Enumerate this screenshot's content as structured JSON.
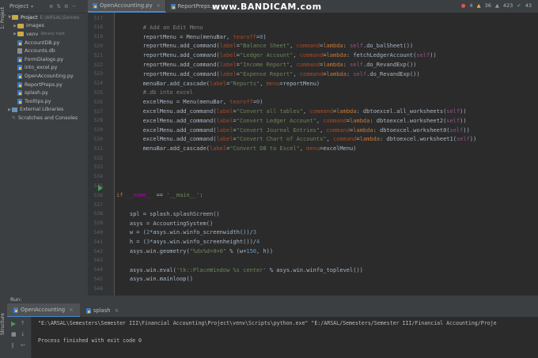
{
  "project_panel": {
    "title": "Project",
    "root": {
      "name": "Project",
      "path": "E:\\ARSAL\\Semes"
    },
    "items": [
      {
        "label": "images",
        "type": "folder",
        "note": ""
      },
      {
        "label": "venv",
        "type": "folder",
        "note": "library root"
      },
      {
        "label": "AccountDB.py",
        "type": "py"
      },
      {
        "label": "Accounts.db",
        "type": "db"
      },
      {
        "label": "FormDialogs.py",
        "type": "py"
      },
      {
        "label": "into_excel.py",
        "type": "py"
      },
      {
        "label": "OpenAccounting.py",
        "type": "py"
      },
      {
        "label": "ReportPreps.py",
        "type": "py"
      },
      {
        "label": "splash.py",
        "type": "py"
      },
      {
        "label": "Tooltips.py",
        "type": "py"
      }
    ],
    "external_libraries": "External Libraries",
    "scratches": "Scratches and Consoles"
  },
  "tabs": [
    {
      "label": "OpenAccounting.py",
      "active": true
    },
    {
      "label": "ReportPreps.py",
      "active": false
    }
  ],
  "watermark": "www.BANDICAM.com",
  "inspections": {
    "errors": "4",
    "warnings": "36",
    "weak_warnings": "423",
    "typos": "43"
  },
  "line_numbers": [
    "517",
    "518",
    "519",
    "520",
    "521",
    "522",
    "523",
    "524",
    "525",
    "526",
    "527",
    "528",
    "529",
    "530",
    "531",
    "532",
    "533",
    "534",
    "535",
    "536",
    "537",
    "538",
    "539",
    "540",
    "541",
    "542",
    "543",
    "544",
    "545",
    "546"
  ],
  "left_strip": {
    "project_label": "1: Project",
    "structure_label": "Structure"
  },
  "run": {
    "label": "Run:",
    "tabs": [
      {
        "label": "OpenAccounting",
        "active": true
      },
      {
        "label": "splash",
        "active": false
      }
    ],
    "console": [
      "\"E:\\ARSAL\\Semesters\\Semester III\\Financial Accounting\\Project\\venv\\Scripts\\python.exe\" \"E:/ARSAL/Semesters/Semester III/Financial Accounting/Proje",
      "",
      "Process finished with exit code 0"
    ]
  },
  "code_lines": [
    {
      "n": "517",
      "parts": []
    },
    {
      "n": "518",
      "parts": [
        [
          "cm",
          "        # Add an Edit Menu"
        ]
      ]
    },
    {
      "n": "519",
      "parts": [
        [
          "t",
          "        reportMenu = Menu(menuBar, "
        ],
        [
          "par",
          "tearoff"
        ],
        [
          "t",
          "="
        ],
        [
          "num",
          "0"
        ],
        [
          "t",
          ")"
        ]
      ]
    },
    {
      "n": "520",
      "parts": [
        [
          "t",
          "        reportMenu.add_command("
        ],
        [
          "par",
          "label"
        ],
        [
          "t",
          "="
        ],
        [
          "str",
          "\"Balance Sheet\""
        ],
        [
          "t",
          ", "
        ],
        [
          "par",
          "command"
        ],
        [
          "t",
          "="
        ],
        [
          "kw",
          "lambda"
        ],
        [
          "t",
          ": "
        ],
        [
          "self",
          "self"
        ],
        [
          "t",
          ".do_balSheet())"
        ]
      ]
    },
    {
      "n": "521",
      "parts": [
        [
          "t",
          "        reportMenu.add_command("
        ],
        [
          "par",
          "label"
        ],
        [
          "t",
          "="
        ],
        [
          "str",
          "\"Ledger Account\""
        ],
        [
          "t",
          ", "
        ],
        [
          "par",
          "command"
        ],
        [
          "t",
          "="
        ],
        [
          "kw",
          "lambda"
        ],
        [
          "t",
          ": fetchLedgerAccount("
        ],
        [
          "self",
          "self"
        ],
        [
          "t",
          "))"
        ]
      ]
    },
    {
      "n": "522",
      "parts": [
        [
          "t",
          "        reportMenu.add_command("
        ],
        [
          "par",
          "label"
        ],
        [
          "t",
          "="
        ],
        [
          "str",
          "\"Income Report\""
        ],
        [
          "t",
          ", "
        ],
        [
          "par",
          "command"
        ],
        [
          "t",
          "="
        ],
        [
          "kw",
          "lambda"
        ],
        [
          "t",
          ": "
        ],
        [
          "self",
          "self"
        ],
        [
          "t",
          ".do_RevandExp())"
        ]
      ]
    },
    {
      "n": "523",
      "parts": [
        [
          "t",
          "        reportMenu.add_command("
        ],
        [
          "par",
          "label"
        ],
        [
          "t",
          "="
        ],
        [
          "str",
          "\"Expense Report\""
        ],
        [
          "t",
          ", "
        ],
        [
          "par",
          "command"
        ],
        [
          "t",
          "="
        ],
        [
          "kw",
          "lambda"
        ],
        [
          "t",
          ": "
        ],
        [
          "self",
          "self"
        ],
        [
          "t",
          ".do_RevandExp())"
        ]
      ]
    },
    {
      "n": "524",
      "parts": [
        [
          "t",
          "        menuBar.add_cascade("
        ],
        [
          "par",
          "label"
        ],
        [
          "t",
          "="
        ],
        [
          "str",
          "\"Reports\""
        ],
        [
          "t",
          ", "
        ],
        [
          "par",
          "menu"
        ],
        [
          "t",
          "=reportMenu)"
        ]
      ]
    },
    {
      "n": "525",
      "parts": [
        [
          "cm",
          "        #.db into excel"
        ]
      ]
    },
    {
      "n": "526",
      "parts": [
        [
          "t",
          "        excelMenu = Menu(menuBar, "
        ],
        [
          "par",
          "tearoff"
        ],
        [
          "t",
          "="
        ],
        [
          "num",
          "0"
        ],
        [
          "t",
          ")"
        ]
      ]
    },
    {
      "n": "527",
      "parts": [
        [
          "t",
          "        excelMenu.add_command("
        ],
        [
          "par",
          "label"
        ],
        [
          "t",
          "="
        ],
        [
          "str",
          "\"Convert all tables\""
        ],
        [
          "t",
          ", "
        ],
        [
          "par",
          "command"
        ],
        [
          "t",
          "="
        ],
        [
          "kw",
          "lambda"
        ],
        [
          "t",
          ": dbtoexcel.all_worksheets("
        ],
        [
          "self",
          "self"
        ],
        [
          "t",
          "))"
        ]
      ]
    },
    {
      "n": "528",
      "parts": [
        [
          "t",
          "        excelMenu.add_command("
        ],
        [
          "par",
          "label"
        ],
        [
          "t",
          "="
        ],
        [
          "str",
          "\"Convert Ledger Account\""
        ],
        [
          "t",
          ", "
        ],
        [
          "par",
          "command"
        ],
        [
          "t",
          "="
        ],
        [
          "kw",
          "lambda"
        ],
        [
          "t",
          ": dbtoexcel.worksheet2("
        ],
        [
          "self",
          "self"
        ],
        [
          "t",
          "))"
        ]
      ]
    },
    {
      "n": "529",
      "parts": [
        [
          "t",
          "        excelMenu.add_command("
        ],
        [
          "par",
          "label"
        ],
        [
          "t",
          "="
        ],
        [
          "str",
          "\"Convert Journal Entries\""
        ],
        [
          "t",
          ", "
        ],
        [
          "par",
          "command"
        ],
        [
          "t",
          "="
        ],
        [
          "kw",
          "lambda"
        ],
        [
          "t",
          ": dbtoexcel.worksheet0("
        ],
        [
          "self",
          "self"
        ],
        [
          "t",
          "))"
        ]
      ]
    },
    {
      "n": "530",
      "parts": [
        [
          "t",
          "        excelMenu.add_command("
        ],
        [
          "par",
          "label"
        ],
        [
          "t",
          "="
        ],
        [
          "str",
          "\"Convert Chart of Accounts\""
        ],
        [
          "t",
          ", "
        ],
        [
          "par",
          "command"
        ],
        [
          "t",
          "="
        ],
        [
          "kw",
          "lambda"
        ],
        [
          "t",
          ": dbtoexcel.worksheet1("
        ],
        [
          "self",
          "self"
        ],
        [
          "t",
          "))"
        ]
      ]
    },
    {
      "n": "531",
      "parts": [
        [
          "t",
          "        menuBar.add_cascade("
        ],
        [
          "par",
          "label"
        ],
        [
          "t",
          "="
        ],
        [
          "str",
          "\"Convert DB to Excel\""
        ],
        [
          "t",
          ", "
        ],
        [
          "par",
          "menu"
        ],
        [
          "t",
          "=excelMenu)"
        ]
      ]
    },
    {
      "n": "532",
      "parts": []
    },
    {
      "n": "533",
      "parts": []
    },
    {
      "n": "534",
      "parts": []
    },
    {
      "n": "535",
      "parts": []
    },
    {
      "n": "536",
      "parts": [
        [
          "kw",
          "if"
        ],
        [
          "t",
          " "
        ],
        [
          "dund",
          "__name__"
        ],
        [
          "t",
          " == "
        ],
        [
          "str",
          "'__main__'"
        ],
        [
          "t",
          ":"
        ]
      ]
    },
    {
      "n": "537",
      "parts": []
    },
    {
      "n": "538",
      "parts": [
        [
          "t",
          "    spl = splash.splashScreen()"
        ]
      ]
    },
    {
      "n": "539",
      "parts": [
        [
          "t",
          "    asys = AccountingSystem()"
        ]
      ]
    },
    {
      "n": "540",
      "parts": [
        [
          "t",
          "    w = ("
        ],
        [
          "num",
          "2"
        ],
        [
          "t",
          "*asys.win.winfo_screenwidth())/"
        ],
        [
          "num",
          "3"
        ]
      ]
    },
    {
      "n": "541",
      "parts": [
        [
          "t",
          "    h = ("
        ],
        [
          "num",
          "3"
        ],
        [
          "t",
          "*asys.win.winfo_screenheight())/"
        ],
        [
          "num",
          "4"
        ]
      ]
    },
    {
      "n": "542",
      "parts": [
        [
          "t",
          "    asys.win.geometry("
        ],
        [
          "str",
          "\"%dx%d+0+0\""
        ],
        [
          "t",
          " % (w+"
        ],
        [
          "num",
          "150"
        ],
        [
          "t",
          ", h))"
        ]
      ]
    },
    {
      "n": "543",
      "parts": []
    },
    {
      "n": "544",
      "parts": [
        [
          "t",
          "    asys.win.eval("
        ],
        [
          "str",
          "'tk::PlaceWindow %s center'"
        ],
        [
          "t",
          " % asys.win.winfo_toplevel())"
        ]
      ]
    },
    {
      "n": "545",
      "parts": [
        [
          "t",
          "    asys.win.mainloop()"
        ]
      ]
    },
    {
      "n": "546",
      "parts": []
    }
  ]
}
